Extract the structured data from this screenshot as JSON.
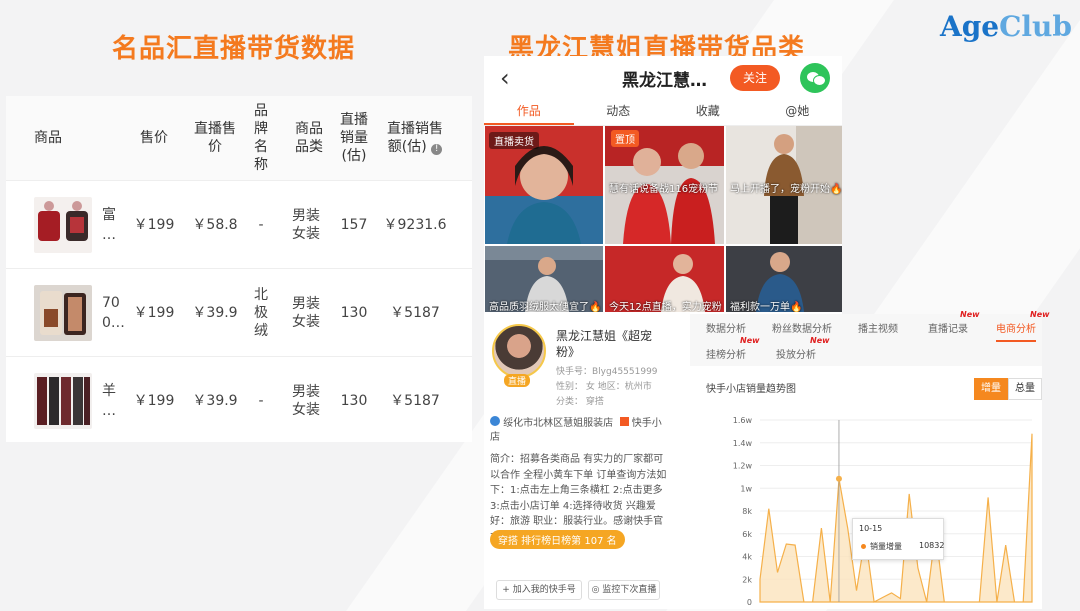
{
  "headings": {
    "left": "名品汇直播带货数据",
    "right": "黑龙江慧姐直播带货品类"
  },
  "logo": {
    "age": "Age",
    "club": "Club"
  },
  "table": {
    "headers": [
      "商品",
      "售价",
      "直播售价",
      "品牌名称",
      "商品品类",
      "直播销量(估)",
      "直播销售额(估)"
    ],
    "header_lines": {
      "h2": [
        "直播售",
        "价"
      ],
      "h3": [
        "品",
        "牌",
        "名",
        "称"
      ],
      "h4": [
        "商品",
        "品类"
      ],
      "h5": [
        "直播",
        "销量",
        "(估)"
      ],
      "h6": [
        "直播销售",
        "额(估)"
      ]
    },
    "info_icon": "info-icon",
    "rows": [
      {
        "name": [
          "富",
          "…"
        ],
        "price": "￥199",
        "live_price": "￥58.8",
        "brand": [
          "-"
        ],
        "category": [
          "男装",
          "女装"
        ],
        "sales": "157",
        "revenue": "￥9231.6"
      },
      {
        "name": [
          "70",
          "0…"
        ],
        "price": "￥199",
        "live_price": "￥39.9",
        "brand": [
          "北",
          "极",
          "绒"
        ],
        "category": [
          "男装",
          "女装"
        ],
        "sales": "130",
        "revenue": "￥5187"
      },
      {
        "name": [
          "羊",
          "…"
        ],
        "price": "￥199",
        "live_price": "￥39.9",
        "brand": [
          "-"
        ],
        "category": [
          "男装",
          "女装"
        ],
        "sales": "130",
        "revenue": "￥5187"
      }
    ]
  },
  "phone": {
    "back_icon": "‹",
    "title": "黑龙江慧…",
    "follow": "关注",
    "tabs": [
      "作品",
      "动态",
      "收藏",
      "@她"
    ],
    "videos": [
      {
        "badge": "直播卖货",
        "caption": ""
      },
      {
        "badge": "置顶",
        "caption": "慧有话说备战116宠粉节"
      },
      {
        "badge": "",
        "caption": "马上开播了，宠粉开始🔥"
      },
      {
        "badge": "",
        "caption": "高品质羽绒服太便宜了🔥"
      },
      {
        "badge": "",
        "caption": "今天12点直播，实力宠粉"
      },
      {
        "badge": "",
        "caption": "福利款一万单🔥"
      }
    ]
  },
  "profile": {
    "live_tag": "直播",
    "name": "黑龙江慧姐《超宠粉》",
    "kuaishou_id": "快手号：Blyg45551999",
    "gender_region": "性别：  女    地区：杭州市",
    "category": "分类：  穿搭",
    "shop": "绥化市北林区慧姐服装店",
    "shop_tag": "快手小店",
    "intro": "简介：招募各类商品 有实力的厂家都可以合作 全程小黄车下单 订单查询方法如下：1:点击左上角三条横杠 2:点击更多 3:点击小店订单 4:选择待收货 兴趣爱好：旅游 职业：服装行业。感谢快手官方平台",
    "rank": "穿搭 排行榜日榜第 107 名",
    "btn_add": "加入我的快手号",
    "btn_monitor": "监控下次直播"
  },
  "analytics": {
    "tabs": [
      "数据分析",
      "粉丝数据分析",
      "播主视频",
      "直播记录",
      "电商分析",
      "挂榜分析",
      "投放分析"
    ],
    "new_label": "New",
    "chart_title": "快手小店销量趋势图",
    "toggle": [
      "增量",
      "总量"
    ],
    "tooltip": {
      "date": "10-15",
      "series": "销量增量",
      "value": "10832"
    }
  },
  "chart_data": {
    "type": "area",
    "title": "快手小店销量趋势图",
    "y_tick_labels": [
      "0",
      "2k",
      "4k",
      "6k",
      "8k",
      "1w",
      "1.2w",
      "1.4w",
      "1.6w"
    ],
    "ylim": [
      0,
      16000
    ],
    "highlight": {
      "x": "10-15",
      "y": 10832
    },
    "series": [
      {
        "values": [
          2000,
          8200,
          2600,
          5100,
          5000,
          0,
          0,
          6500,
          0,
          10832,
          6500,
          1000,
          5800,
          0,
          400,
          800,
          300,
          9500,
          3000,
          0,
          6200,
          0,
          0,
          0,
          0,
          0,
          9200,
          0,
          5000,
          0,
          0,
          14800
        ]
      }
    ],
    "color": "#f5b04a",
    "grid": true
  }
}
